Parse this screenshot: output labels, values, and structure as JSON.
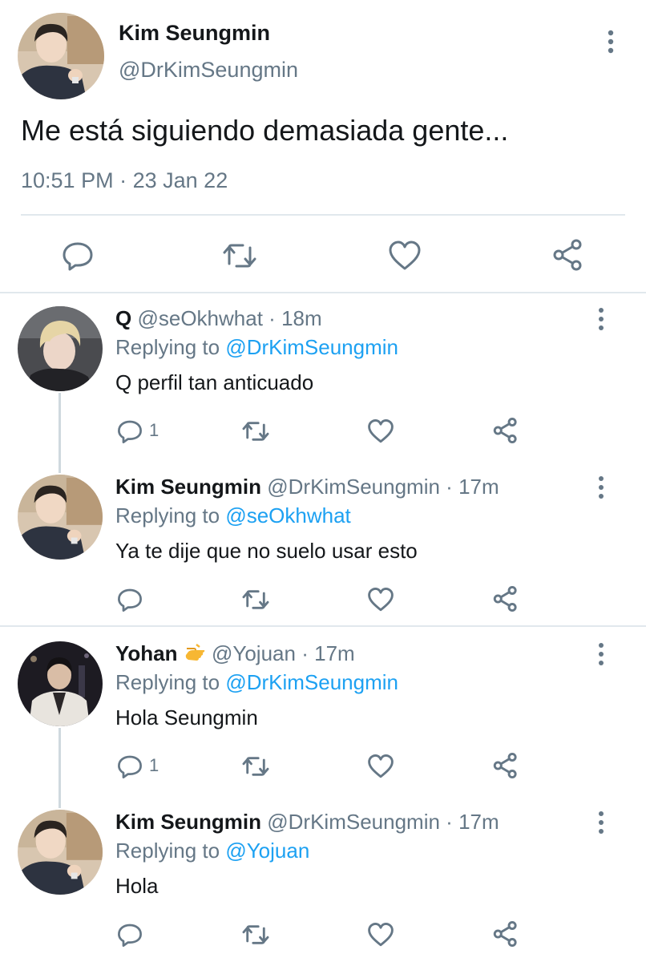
{
  "colors": {
    "text": "#14171a",
    "secondary": "#657786",
    "link": "#1da1f2",
    "divider": "#e1e8ed"
  },
  "main_tweet": {
    "name": "Kim Seungmin",
    "handle": "@DrKimSeungmin",
    "text": "Me está siguiendo demasiada gente...",
    "time": "10:51 PM",
    "date": "23 Jan 22",
    "separator": "·",
    "actions": [
      "reply-icon",
      "retweet-icon",
      "like-icon",
      "share-icon"
    ]
  },
  "replies": [
    {
      "name": "Q",
      "handle": "@seOkhwhat",
      "age": "18m",
      "replying_prefix": "Replying to ",
      "replying_to": "@DrKimSeungmin",
      "text": "Q perfil tan anticuado",
      "reply_count": "1",
      "avatar": "blonde-person-avatar"
    },
    {
      "name": "Kim Seungmin",
      "handle": "@DrKimSeungmin",
      "age": "17m",
      "replying_prefix": "Replying to ",
      "replying_to": "@seOkhwhat",
      "text": "Ya te dije que no suelo usar esto",
      "reply_count": "",
      "avatar": "kim-seungmin-avatar"
    },
    {
      "name": "Yohan",
      "emoji": "backhand-index-pointing-left-emoji",
      "handle": "@Yojuan",
      "age": "17m",
      "replying_prefix": "Replying to ",
      "replying_to": "@DrKimSeungmin",
      "text": "Hola Seungmin",
      "reply_count": "1",
      "avatar": "yohan-avatar"
    },
    {
      "name": "Kim Seungmin",
      "handle": "@DrKimSeungmin",
      "age": "17m",
      "replying_prefix": "Replying to ",
      "replying_to": "@Yojuan",
      "text": "Hola",
      "reply_count": "",
      "avatar": "kim-seungmin-avatar"
    }
  ]
}
